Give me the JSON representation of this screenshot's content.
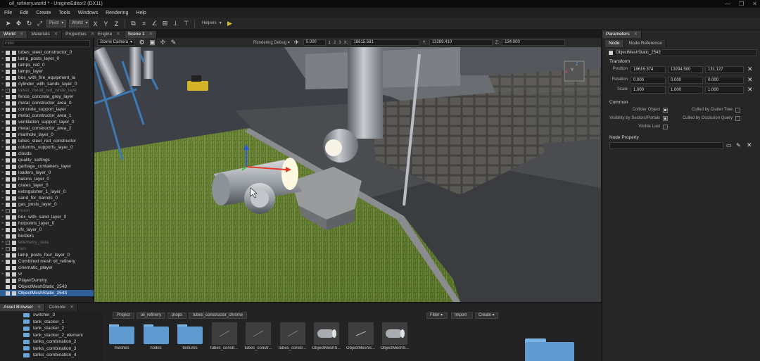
{
  "window": {
    "title": "oil_refinery.world * - UnigineEditor2 (DX11)",
    "controls": [
      "—",
      "❐",
      "✕"
    ]
  },
  "menu": [
    "File",
    "Edit",
    "Create",
    "Tools",
    "Windows",
    "Rendering",
    "Help"
  ],
  "toolbar": {
    "pivot": "Pivot",
    "space": "World",
    "x": "X",
    "y": "Y",
    "z": "Z",
    "helpers": "Helpers"
  },
  "left_tabs": [
    "World",
    "Materials",
    "Properties"
  ],
  "world": {
    "filter_placeholder": "Filter",
    "items": [
      {
        "label": "tubes_steel_constructor_0",
        "arrow": "▸",
        "check": true,
        "dim": false,
        "sel": false
      },
      {
        "label": "lamp_posts_layer_0",
        "arrow": "▸",
        "check": true,
        "dim": false,
        "sel": false
      },
      {
        "label": "lamps_red_0",
        "arrow": "▸",
        "check": true,
        "dim": false,
        "sel": false
      },
      {
        "label": "lamps_layer",
        "arrow": "▸",
        "check": true,
        "dim": false,
        "sel": false
      },
      {
        "label": "box_with_fire_equipment_la",
        "arrow": "▸",
        "check": true,
        "dim": false,
        "sel": false
      },
      {
        "label": "cylinder_with_sands_layer_0",
        "arrow": "▸",
        "check": true,
        "dim": false,
        "sel": false
      },
      {
        "label": "tower_metal_red_white_laye",
        "arrow": "▸",
        "check": false,
        "dim": true,
        "sel": false
      },
      {
        "label": "fence_concrete_grey_layer",
        "arrow": "▸",
        "check": true,
        "dim": false,
        "sel": false
      },
      {
        "label": "metal_constructor_area_0",
        "arrow": "▸",
        "check": true,
        "dim": false,
        "sel": false
      },
      {
        "label": "concrete_support_layer",
        "arrow": "▸",
        "check": true,
        "dim": false,
        "sel": false
      },
      {
        "label": "metal_constructor_area_1",
        "arrow": "▸",
        "check": true,
        "dim": false,
        "sel": false
      },
      {
        "label": "ventilation_support_layer_0",
        "arrow": "▸",
        "check": true,
        "dim": false,
        "sel": false
      },
      {
        "label": "metal_constructor_area_2",
        "arrow": "▸",
        "check": true,
        "dim": false,
        "sel": false
      },
      {
        "label": "manhole_layer_0",
        "arrow": "▸",
        "check": true,
        "dim": false,
        "sel": false
      },
      {
        "label": "tubes_steel_red_constructor",
        "arrow": "▸",
        "check": true,
        "dim": false,
        "sel": false
      },
      {
        "label": "columns_supports_layer_0",
        "arrow": "▸",
        "check": true,
        "dim": false,
        "sel": false
      },
      {
        "label": "clouds",
        "arrow": "",
        "check": true,
        "dim": false,
        "sel": false
      },
      {
        "label": "quality_settings",
        "arrow": "▸",
        "check": true,
        "dim": false,
        "sel": false
      },
      {
        "label": "garbage_containers_layer",
        "arrow": "▸",
        "check": true,
        "dim": false,
        "sel": false
      },
      {
        "label": "loaders_layer_0",
        "arrow": "▸",
        "check": true,
        "dim": false,
        "sel": false
      },
      {
        "label": "balons_layer_0",
        "arrow": "▸",
        "check": true,
        "dim": false,
        "sel": false
      },
      {
        "label": "crates_layer_0",
        "arrow": "▸",
        "check": true,
        "dim": false,
        "sel": false
      },
      {
        "label": "extinguisher_1_layer_0",
        "arrow": "▸",
        "check": true,
        "dim": false,
        "sel": false
      },
      {
        "label": "sand_for_barrels_0",
        "arrow": "▸",
        "check": true,
        "dim": false,
        "sel": false
      },
      {
        "label": "gas_posts_layer_0",
        "arrow": "▸",
        "check": true,
        "dim": false,
        "sel": false
      },
      {
        "label": "moon",
        "arrow": "▸",
        "check": false,
        "dim": true,
        "sel": false
      },
      {
        "label": "box_with_sand_layer_0",
        "arrow": "▸",
        "check": true,
        "dim": false,
        "sel": false
      },
      {
        "label": "hotpoints_layer_0",
        "arrow": "▸",
        "check": true,
        "dim": false,
        "sel": false
      },
      {
        "label": "vfx_layer_0",
        "arrow": "▸",
        "check": true,
        "dim": false,
        "sel": false
      },
      {
        "label": "borders",
        "arrow": "▸",
        "check": true,
        "dim": false,
        "sel": false
      },
      {
        "label": "telemetry_data",
        "arrow": "▸",
        "check": false,
        "dim": true,
        "sel": false
      },
      {
        "label": "rain",
        "arrow": "▸",
        "check": false,
        "dim": true,
        "sel": false
      },
      {
        "label": "lamp_posts_four_layer_0",
        "arrow": "▸",
        "check": true,
        "dim": false,
        "sel": false
      },
      {
        "label": "Combined mesh oil_refinery",
        "arrow": "▸",
        "check": true,
        "dim": false,
        "sel": false
      },
      {
        "label": "cinematic_player",
        "arrow": "",
        "check": true,
        "dim": false,
        "sel": false
      },
      {
        "label": "vr",
        "arrow": "▸",
        "check": true,
        "dim": false,
        "sel": false
      },
      {
        "label": "PlayerDummy",
        "arrow": "",
        "check": true,
        "dim": false,
        "sel": false
      },
      {
        "label": "ObjectMeshStatic_2543",
        "arrow": "",
        "check": true,
        "dim": false,
        "sel": false
      },
      {
        "label": "ObjectMeshStatic_2543",
        "arrow": "",
        "check": true,
        "dim": false,
        "sel": true
      }
    ]
  },
  "center_tabs": [
    "Engine",
    "Scene 1"
  ],
  "viewport_bar": {
    "camera": "Scene Camera",
    "rendering_debug": "Rendering Debug",
    "speed": "5.000",
    "snap_1": "1",
    "snap_2": "2",
    "snap_3": "3",
    "x_label": "X:",
    "x": "18615.581",
    "y_label": "Y:",
    "y": "13289.410",
    "z_label": "Z:",
    "z": "134.000"
  },
  "gizmo": {
    "x": "X",
    "y": "Y",
    "z": "Z"
  },
  "params": {
    "tab": "Parameters",
    "subtabs": [
      "Node",
      "Node Reference"
    ],
    "node_name": "ObjectMeshStatic_2543",
    "transform_title": "Transform",
    "position_label": "Position",
    "position": [
      "18616.374",
      "13294.500",
      "131.127"
    ],
    "rotation_label": "Rotation",
    "rotation": [
      "0.000",
      "0.000",
      "0.000"
    ],
    "scale_label": "Scale",
    "scale": [
      "1.000",
      "1.000",
      "1.000"
    ],
    "common_title": "Common",
    "collider": "Collider Object",
    "clutter": "Culled by Clutter Tree",
    "visibility": "Visibility by Sectors/Portals",
    "occlusion": "Culled by Occlusion Query",
    "visible_last": "Visible Last",
    "node_property_title": "Node Property"
  },
  "bottom_tabs": [
    "Asset Browser",
    "Console"
  ],
  "tree": [
    "switcher_3",
    "tank_stacker_1",
    "tank_stacker_2",
    "tank_stacker_2_element",
    "tanks_combination_2",
    "tanks_combination_3",
    "tanks_combination_4"
  ],
  "asset_browser": {
    "breadcrumbs": [
      "Project",
      "oil_refinery",
      "props",
      "tubes_constructor_chrome"
    ],
    "filter_btn": "Filter",
    "import_btn": "Import",
    "create_btn": "Create",
    "items": [
      {
        "label": "meshes",
        "kind": "folder"
      },
      {
        "label": "nodes",
        "kind": "folder"
      },
      {
        "label": "textures",
        "kind": "folder"
      },
      {
        "label": "tubes_constr...",
        "kind": "mesh"
      },
      {
        "label": "tubes_constr...",
        "kind": "mesh"
      },
      {
        "label": "tubes_constr...",
        "kind": "mesh"
      },
      {
        "label": "ObjectMeshS...",
        "kind": "tube"
      },
      {
        "label": "ObjectMeshS...",
        "kind": "line"
      },
      {
        "label": "ObjectMeshS...",
        "kind": "tube"
      }
    ]
  },
  "colors": {
    "accent": "#2f5f99",
    "folder": "#6aa4d8",
    "grass": "#55702a",
    "gizmo_x": "#e53a2a",
    "gizmo_y": "#3ac23a",
    "gizmo_z": "#2a5ae5"
  }
}
